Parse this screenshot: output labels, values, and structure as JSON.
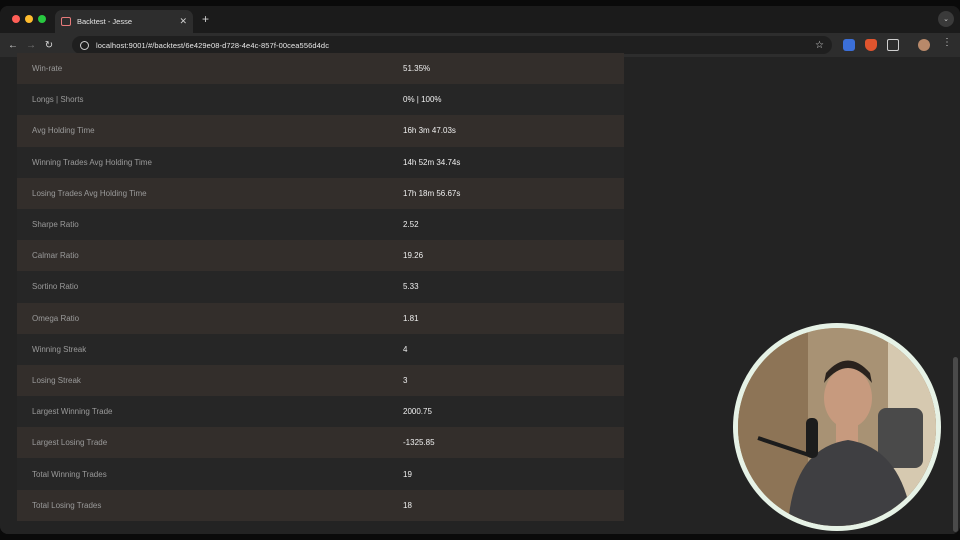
{
  "browser": {
    "tab_title": "Backtest - Jesse",
    "url": "localhost:9001/#/backtest/6e429e08-d728-4e4c-857f-00cea556d4dc"
  },
  "metrics": [
    {
      "label": "Win-rate",
      "value": "51.35%"
    },
    {
      "label": "Longs | Shorts",
      "value": "0% | 100%"
    },
    {
      "label": "Avg Holding Time",
      "value": "16h 3m 47.03s"
    },
    {
      "label": "Winning Trades Avg Holding Time",
      "value": "14h 52m 34.74s"
    },
    {
      "label": "Losing Trades Avg Holding Time",
      "value": "17h 18m 56.67s"
    },
    {
      "label": "Sharpe Ratio",
      "value": "2.52"
    },
    {
      "label": "Calmar Ratio",
      "value": "19.26"
    },
    {
      "label": "Sortino Ratio",
      "value": "5.33"
    },
    {
      "label": "Omega Ratio",
      "value": "1.81"
    },
    {
      "label": "Winning Streak",
      "value": "4"
    },
    {
      "label": "Losing Streak",
      "value": "3"
    },
    {
      "label": "Largest Winning Trade",
      "value": "2000.75"
    },
    {
      "label": "Largest Losing Trade",
      "value": "-1325.85"
    },
    {
      "label": "Total Winning Trades",
      "value": "19"
    },
    {
      "label": "Total Losing Trades",
      "value": "18"
    }
  ]
}
